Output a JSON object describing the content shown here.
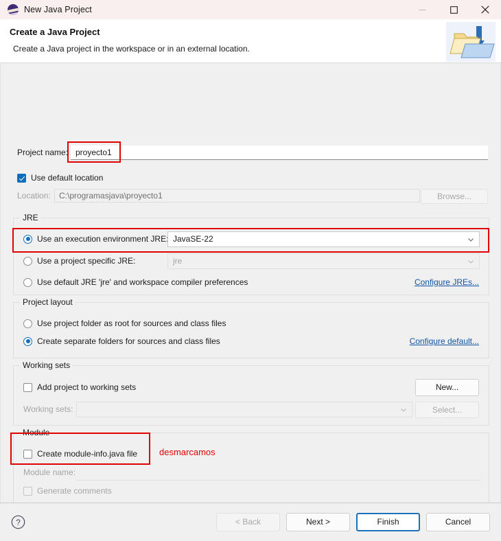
{
  "window": {
    "title": "New Java Project",
    "icon": "eclipse-icon",
    "controls": {
      "minimize": "minimize-icon",
      "maximize": "maximize-icon",
      "close": "close-icon"
    }
  },
  "header": {
    "title": "Create a Java Project",
    "description": "Create a Java project in the workspace or in an external location.",
    "graphic": "java-project-folder-icon"
  },
  "project_name": {
    "label": "Project name:",
    "value": "proyecto1",
    "placeholder": ""
  },
  "location": {
    "use_default_label": "Use default location",
    "use_default_checked": true,
    "label": "Location:",
    "value": "C:\\programasjava\\proyecto1",
    "browse_label": "Browse..."
  },
  "jre": {
    "group_title": "JRE",
    "option_execution_env": "Use an execution environment JRE:",
    "execution_env_value": "JavaSE-22",
    "option_project_specific": "Use a project specific JRE:",
    "project_specific_value": "jre",
    "option_default": "Use default JRE 'jre' and workspace compiler preferences",
    "configure_link": "Configure JREs...",
    "selected": "execution_env"
  },
  "project_layout": {
    "group_title": "Project layout",
    "option_root": "Use project folder as root for sources and class files",
    "option_separate": "Create separate folders for sources and class files",
    "configure_link": "Configure default...",
    "selected": "separate"
  },
  "working_sets": {
    "group_title": "Working sets",
    "add_label": "Add project to working sets",
    "add_checked": false,
    "label": "Working sets:",
    "value": "",
    "new_label": "New...",
    "select_label": "Select..."
  },
  "module": {
    "group_title": "Module",
    "create_label": "Create module-info.java file",
    "create_checked": false,
    "name_label": "Module name:",
    "name_value": "",
    "comments_label": "Generate comments",
    "comments_checked": false
  },
  "annotations": {
    "note_text": "desmarcamos",
    "box_color": "#e00000"
  },
  "footer": {
    "help": "help-icon",
    "back_label": "< Back",
    "next_label": "Next >",
    "finish_label": "Finish",
    "cancel_label": "Cancel",
    "primary": "Finish"
  }
}
